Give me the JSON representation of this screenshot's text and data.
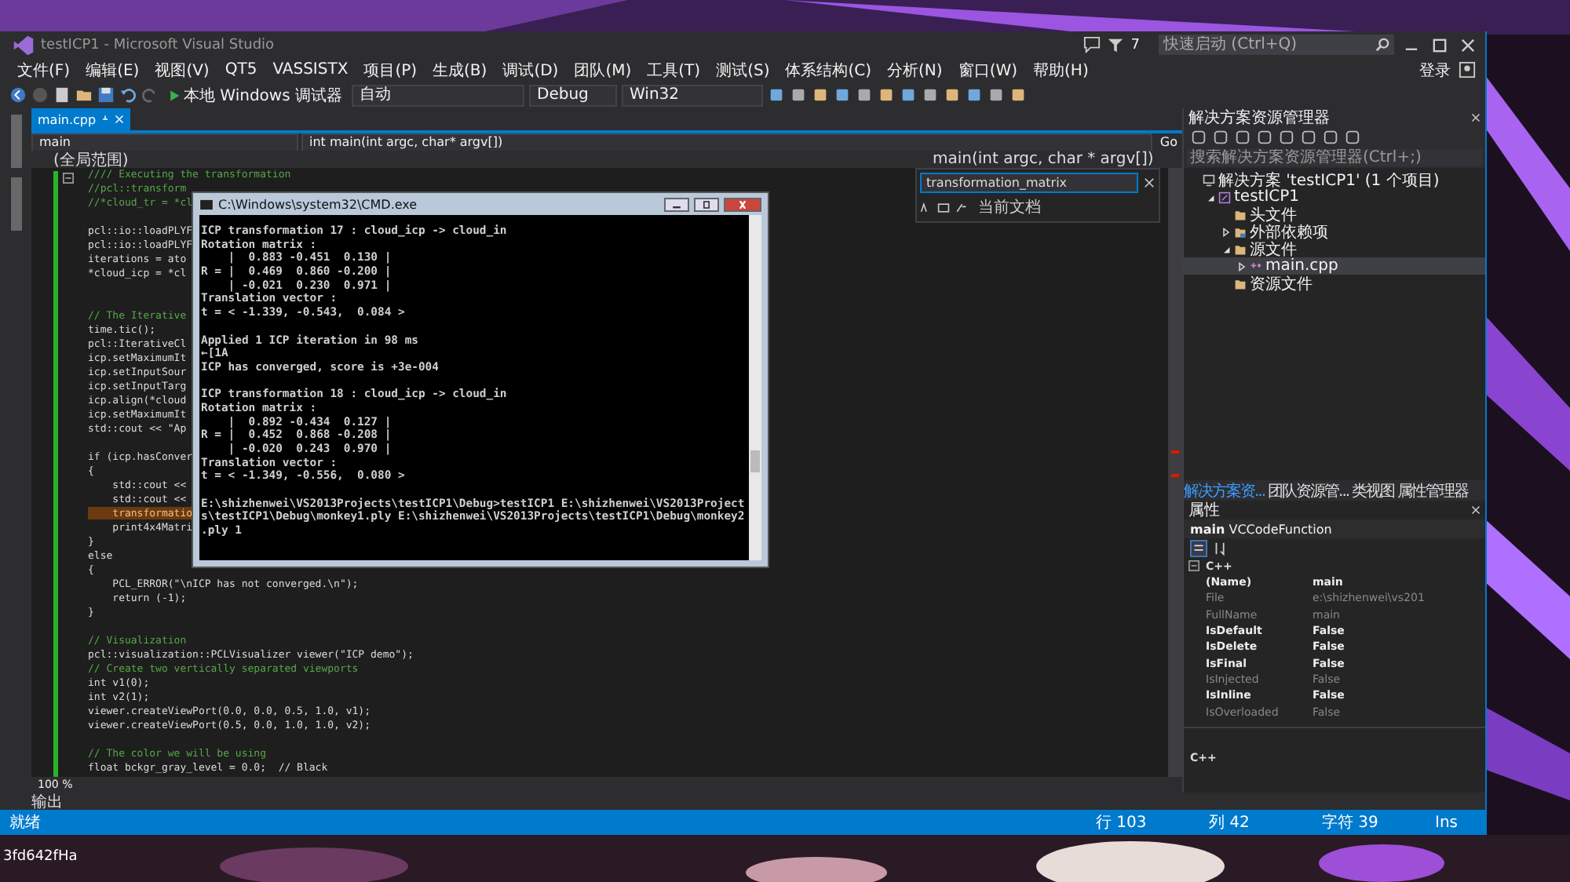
{
  "desktop": {
    "icon_label": "3fd642fHa"
  },
  "window": {
    "title": "testICP1 - Microsoft Visual Studio",
    "notification_count": "7",
    "quick_launch": {
      "placeholder": "快速启动 (Ctrl+Q)"
    }
  },
  "menu": [
    "文件(F)",
    "编辑(E)",
    "视图(V)",
    "QT5",
    "VASSISTX",
    "项目(P)",
    "生成(B)",
    "调试(D)",
    "团队(M)",
    "工具(T)",
    "测试(S)",
    "体系结构(C)",
    "分析(N)",
    "窗口(W)",
    "帮助(H)"
  ],
  "account": "登录",
  "toolbar": {
    "run_button": "本地 Windows 调试器",
    "dropdowns": [
      "自动",
      "Debug",
      "Win32"
    ]
  },
  "tabs": [
    {
      "label": "main.cpp",
      "selected": true
    }
  ],
  "nav": {
    "scope": "main",
    "member": "int main(int argc, char* argv[])",
    "go": "Go"
  },
  "scope_bar": {
    "left": "(全局范围)",
    "right": "main(int argc, char * argv[])"
  },
  "find": {
    "value": "transformation_matrix",
    "scope": "当前文档"
  },
  "code": [
    {
      "kind": "comment",
      "text": "//// Executing the transformation"
    },
    {
      "kind": "comment",
      "text": "//pcl::transform"
    },
    {
      "kind": "comment",
      "text": "//*cloud_tr = *cl"
    },
    {
      "kind": "blank"
    },
    {
      "kind": "code",
      "text": "pcl::io::loadPLYF"
    },
    {
      "kind": "code",
      "text": "pcl::io::loadPLYF"
    },
    {
      "kind": "code",
      "text": "iterations = ato"
    },
    {
      "kind": "code",
      "text": "*cloud_icp = *cl"
    },
    {
      "kind": "blank"
    },
    {
      "kind": "blank"
    },
    {
      "kind": "comment",
      "text": "// The Iterative"
    },
    {
      "kind": "code",
      "text": "time.tic();"
    },
    {
      "kind": "code",
      "text": "pcl::IterativeCl"
    },
    {
      "kind": "code",
      "text": "icp.setMaximumIt"
    },
    {
      "kind": "code",
      "text": "icp.setInputSour"
    },
    {
      "kind": "code",
      "text": "icp.setInputTarg"
    },
    {
      "kind": "code",
      "text": "icp.align(*cloud"
    },
    {
      "kind": "code",
      "text": "icp.setMaximumIt"
    },
    {
      "kind": "code",
      "text": "std::cout << \"Ap"
    },
    {
      "kind": "blank"
    },
    {
      "kind": "code",
      "text": "if (icp.hasConver"
    },
    {
      "kind": "code",
      "text": "{"
    },
    {
      "kind": "code",
      "text": "    std::cout <<"
    },
    {
      "kind": "code",
      "text": "    std::cout <<"
    },
    {
      "kind": "highlight",
      "text": "    transformatio"
    },
    {
      "kind": "code",
      "text": "    print4x4Matri"
    },
    {
      "kind": "code",
      "text": "}"
    },
    {
      "kind": "code",
      "text": "else"
    },
    {
      "kind": "code",
      "text": "{"
    },
    {
      "kind": "code",
      "text": "    PCL_ERROR(\"\\nICP has not converged.\\n\");"
    },
    {
      "kind": "code",
      "text": "    return (-1);"
    },
    {
      "kind": "code",
      "text": "}"
    },
    {
      "kind": "blank"
    },
    {
      "kind": "comment",
      "text": "// Visualization"
    },
    {
      "kind": "code",
      "text": "pcl::visualization::PCLVisualizer viewer(\"ICP demo\");"
    },
    {
      "kind": "comment",
      "text": "// Create two vertically separated viewports"
    },
    {
      "kind": "code",
      "text": "int v1(0);"
    },
    {
      "kind": "code",
      "text": "int v2(1);"
    },
    {
      "kind": "code",
      "text": "viewer.createViewPort(0.0, 0.0, 0.5, 1.0, v1);"
    },
    {
      "kind": "code",
      "text": "viewer.createViewPort(0.5, 0.0, 1.0, 1.0, v2);"
    },
    {
      "kind": "blank"
    },
    {
      "kind": "comment",
      "text": "// The color we will be using"
    },
    {
      "kind": "code",
      "text": "float bckgr_gray_level = 0.0;  // Black"
    }
  ],
  "zoom": "100 %",
  "solution_explorer": {
    "title": "解决方案资源管理器",
    "search": {
      "placeholder": "搜索解决方案资源管理器(Ctrl+;)"
    },
    "tree": [
      {
        "label": "解决方案 'testICP1' (1 个项目)",
        "kind": "solution",
        "selected": false,
        "children": [
          {
            "label": "testICP1",
            "kind": "project",
            "selected": false,
            "expanded": true,
            "children": [
              {
                "label": "头文件",
                "kind": "folder",
                "selected": false
              },
              {
                "label": "外部依赖项",
                "kind": "references",
                "selected": false,
                "expanded": false
              },
              {
                "label": "源文件",
                "kind": "folder",
                "selected": false,
                "expanded": true,
                "children": [
                  {
                    "label": "main.cpp",
                    "kind": "file",
                    "selected": true,
                    "expanded": false
                  }
                ]
              },
              {
                "label": "资源文件",
                "kind": "folder",
                "selected": false
              }
            ]
          }
        ]
      }
    ],
    "tabs": [
      {
        "label": "解决方案资...",
        "selected": true
      },
      {
        "label": "团队资源管...",
        "selected": false
      },
      {
        "label": "类视图",
        "selected": false
      },
      {
        "label": "属性管理器",
        "selected": false
      }
    ]
  },
  "properties": {
    "title": "属性",
    "object": "main",
    "type": "VCCodeFunction",
    "category": "C++",
    "rows": [
      {
        "name": "(Name)",
        "value": "main",
        "readonly": false
      },
      {
        "name": "File",
        "value": "e:\\shizhenwei\\vs201",
        "readonly": true
      },
      {
        "name": "FullName",
        "value": "main",
        "readonly": true
      },
      {
        "name": "IsDefault",
        "value": "False",
        "readonly": false
      },
      {
        "name": "IsDelete",
        "value": "False",
        "readonly": false
      },
      {
        "name": "IsFinal",
        "value": "False",
        "readonly": false
      },
      {
        "name": "IsInjected",
        "value": "False",
        "readonly": true
      },
      {
        "name": "IsInline",
        "value": "False",
        "readonly": false
      },
      {
        "name": "IsOverloaded",
        "value": "False",
        "readonly": true
      }
    ],
    "description": "C++"
  },
  "output_tab": "输出",
  "status_bar": {
    "message": "就绪",
    "line": "行 103",
    "column": "列 42",
    "char": "字符 39",
    "mode": "Ins"
  },
  "console": {
    "title": "C:\\Windows\\system32\\CMD.exe",
    "blocks": [
      {
        "kind": "output",
        "lines": [
          "ICP transformation 17 : cloud_icp -> cloud_in",
          "Rotation matrix :",
          "    |  0.883 -0.451  0.130 |",
          "R = |  0.469  0.860 -0.200 |",
          "    | -0.021  0.230  0.971 |",
          "Translation vector :",
          "t = < -1.339, -0.543,  0.084 >"
        ]
      },
      {
        "kind": "output",
        "lines": [
          "Applied 1 ICP iteration in 98 ms",
          "←[1A",
          "ICP has converged, score is +3e-004"
        ]
      },
      {
        "kind": "output",
        "lines": [
          "ICP transformation 18 : cloud_icp -> cloud_in",
          "Rotation matrix :",
          "    |  0.892 -0.434  0.127 |",
          "R = |  0.452  0.868 -0.208 |",
          "    | -0.020  0.243  0.970 |",
          "Translation vector :",
          "t = < -1.349, -0.556,  0.080 >"
        ]
      },
      {
        "kind": "prompt",
        "lines": [
          "E:\\shizhenwei\\VS2013Projects\\testICP1\\Debug>testICP1 E:\\shizhenwei\\VS2013Project",
          "s\\testICP1\\Debug\\monkey1.ply E:\\shizhenwei\\VS2013Projects\\testICP1\\Debug\\monkey2",
          ".ply 1"
        ]
      }
    ]
  }
}
